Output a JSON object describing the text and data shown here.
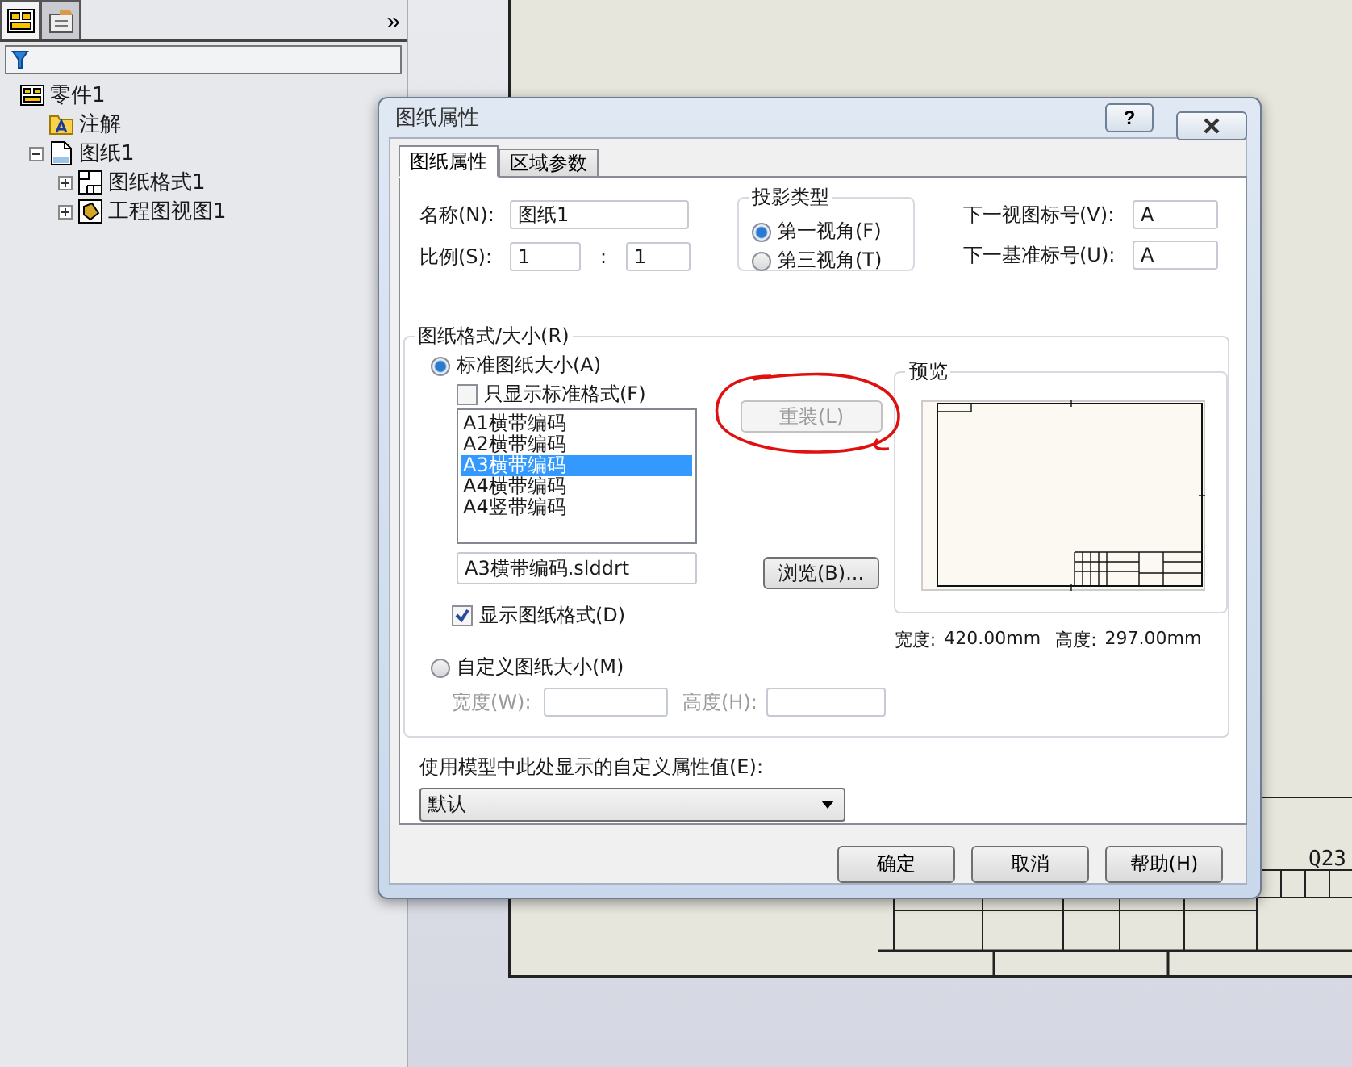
{
  "left_panel": {
    "tabs": [
      {
        "kind": "tree",
        "selected": true
      },
      {
        "kind": "properties",
        "selected": false
      }
    ],
    "more_glyph": "»",
    "tree": [
      {
        "label": "零件1",
        "kind": "part",
        "children": [
          {
            "label": "注解",
            "kind": "annotation"
          },
          {
            "label": "图纸1",
            "kind": "sheet",
            "expanded": true,
            "children": [
              {
                "label": "图纸格式1",
                "kind": "sheet-format",
                "expanded": false
              },
              {
                "label": "工程图视图1",
                "kind": "drawing-view",
                "expanded": false
              }
            ]
          }
        ]
      }
    ]
  },
  "sheet": {
    "title_block_text": "Q23"
  },
  "dialog": {
    "title": "图纸属性",
    "help_glyph": "?",
    "tabs": [
      {
        "label": "图纸属性",
        "selected": true
      },
      {
        "label": "区域参数",
        "selected": false
      }
    ],
    "name_label": "名称(N):",
    "name_value": "图纸1",
    "scale_label": "比例(S):",
    "scale_numerator": "1",
    "scale_separator": ":",
    "scale_denominator": "1",
    "projection": {
      "title": "投影类型",
      "options": [
        {
          "label": "第一视角(F)",
          "selected": true
        },
        {
          "label": "第三视角(T)",
          "selected": false
        }
      ]
    },
    "next_view_label": "下一视图标号(V):",
    "next_view_value": "A",
    "next_datum_label": "下一基准标号(U):",
    "next_datum_value": "A",
    "format_group": {
      "title": "图纸格式/大小(R)",
      "standard_option": {
        "label": "标准图纸大小(A)",
        "selected": true
      },
      "only_standard": {
        "label": "只显示标准格式(F)",
        "checked": false
      },
      "formats": [
        {
          "label": "A1横带编码",
          "selected": false
        },
        {
          "label": "A2横带编码",
          "selected": false
        },
        {
          "label": "A3横带编码",
          "selected": true
        },
        {
          "label": "A4横带编码",
          "selected": false
        },
        {
          "label": "A4竖带编码",
          "selected": false
        }
      ],
      "reload_button": {
        "label": "重装(L)",
        "disabled": true
      },
      "file_value": "A3横带编码.slddrt",
      "browse_button": "浏览(B)...",
      "show_format": {
        "label": "显示图纸格式(D)",
        "checked": true
      },
      "custom_option": {
        "label": "自定义图纸大小(M)",
        "selected": false
      },
      "width_label": "宽度(W):",
      "height_label": "高度(H):"
    },
    "preview": {
      "title": "预览",
      "width_label": "宽度:",
      "width_value": "420.00mm",
      "height_label": "高度:",
      "height_value": "297.00mm"
    },
    "property_label": "使用模型中此处显示的自定义属性值(E):",
    "property_value": "默认",
    "buttons": [
      "确定",
      "取消",
      "帮助(H)"
    ]
  }
}
